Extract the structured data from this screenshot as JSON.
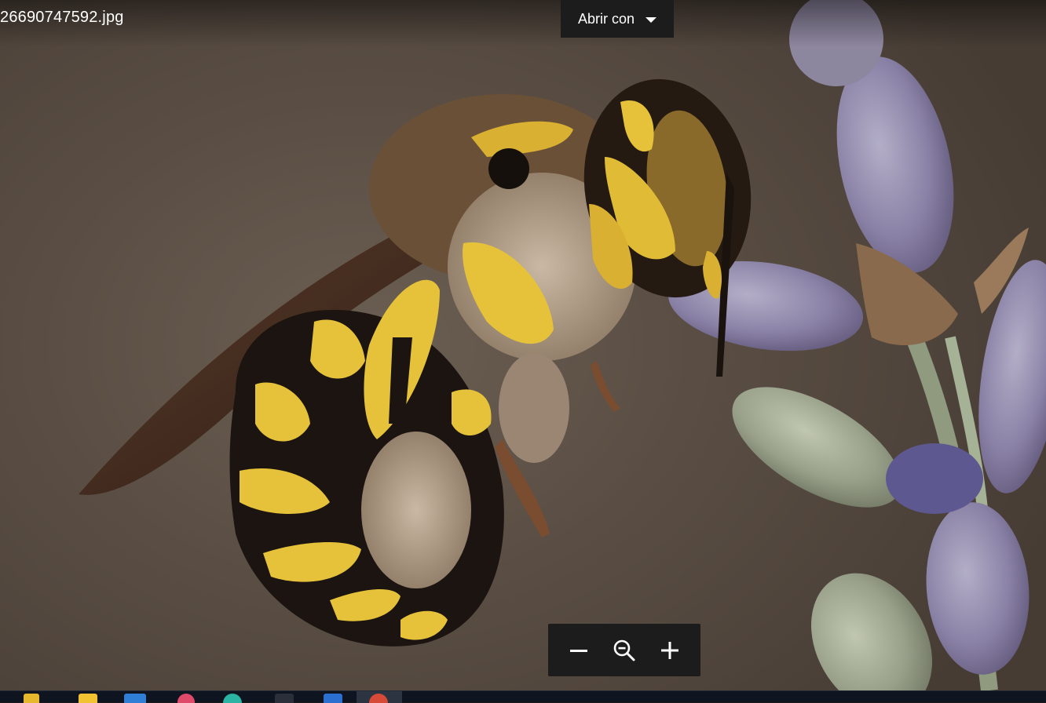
{
  "viewer": {
    "file_name": "26690747592.jpg",
    "open_with_label": "Abrir con",
    "open_with_icon": "chevron-down-icon"
  },
  "zoom_controls": {
    "zoom_out_icon": "minus-icon",
    "reset_zoom_icon": "magnifier-minus-icon",
    "zoom_in_icon": "plus-icon"
  },
  "photo": {
    "subject": "bee",
    "colors": {
      "background": "#5a4e44",
      "bee_yellow": "#e6c23a",
      "bee_black": "#1b1410",
      "lavender": "#8c84a8",
      "stem": "#9aa88a"
    }
  },
  "taskbar": {
    "icons": [
      "file-explorer-icon",
      "app-icon",
      "store-icon",
      "browser-icon",
      "chat-icon",
      "terminal-icon",
      "word-icon",
      "chrome-icon"
    ]
  }
}
